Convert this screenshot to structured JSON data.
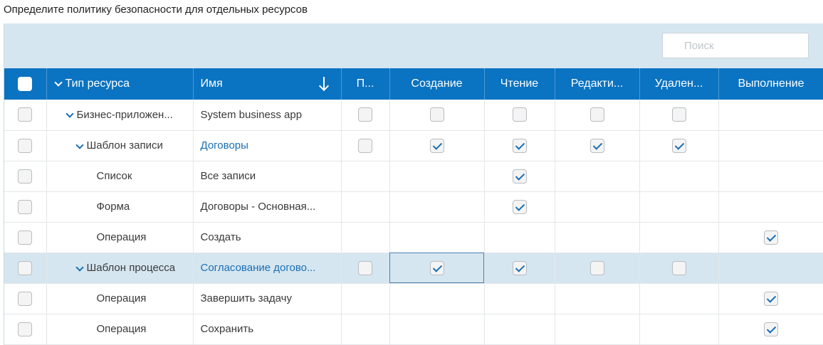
{
  "page_title": "Определите политику безопасности для отдельных ресурсов",
  "search": {
    "placeholder": "Поиск",
    "value": ""
  },
  "columns": {
    "resource_type": "Тип ресурса",
    "name": "Имя",
    "p": "П...",
    "create": "Создание",
    "read": "Чтение",
    "edit": "Редакти...",
    "delete": "Удален...",
    "execute": "Выполнение"
  },
  "rows": [
    {
      "type": "Бизнес-приложен...",
      "name": "System business app",
      "link": false,
      "level": 0,
      "expanded": true,
      "p": false,
      "create": false,
      "read": false,
      "edit": false,
      "delete": false,
      "execute": null
    },
    {
      "type": "Шаблон записи",
      "name": "Договоры",
      "link": true,
      "level": 1,
      "expanded": true,
      "p": false,
      "create": true,
      "read": true,
      "edit": true,
      "delete": true,
      "execute": null
    },
    {
      "type": "Список",
      "name": "Все записи",
      "link": false,
      "level": 2,
      "p": null,
      "create": null,
      "read": true,
      "edit": null,
      "delete": null,
      "execute": null
    },
    {
      "type": "Форма",
      "name": "Договоры - Основная...",
      "link": false,
      "level": 2,
      "p": null,
      "create": null,
      "read": true,
      "edit": null,
      "delete": null,
      "execute": null
    },
    {
      "type": "Операция",
      "name": "Создать",
      "link": false,
      "level": 2,
      "p": null,
      "create": null,
      "read": null,
      "edit": null,
      "delete": null,
      "execute": true
    },
    {
      "type": "Шаблон процесса",
      "name": "Согласование догово...",
      "link": true,
      "level": 1,
      "expanded": true,
      "selected": true,
      "p": false,
      "create": true,
      "read": true,
      "edit": false,
      "delete": false,
      "execute": null
    },
    {
      "type": "Операция",
      "name": "Завершить задачу",
      "link": false,
      "level": 2,
      "p": null,
      "create": null,
      "read": null,
      "edit": null,
      "delete": null,
      "execute": true
    },
    {
      "type": "Операция",
      "name": "Сохранить",
      "link": false,
      "level": 2,
      "p": null,
      "create": null,
      "read": null,
      "edit": null,
      "delete": null,
      "execute": true
    }
  ],
  "colors": {
    "header": "#0a73c2",
    "panel": "#d6e6f0",
    "link": "#1a6fb5"
  }
}
